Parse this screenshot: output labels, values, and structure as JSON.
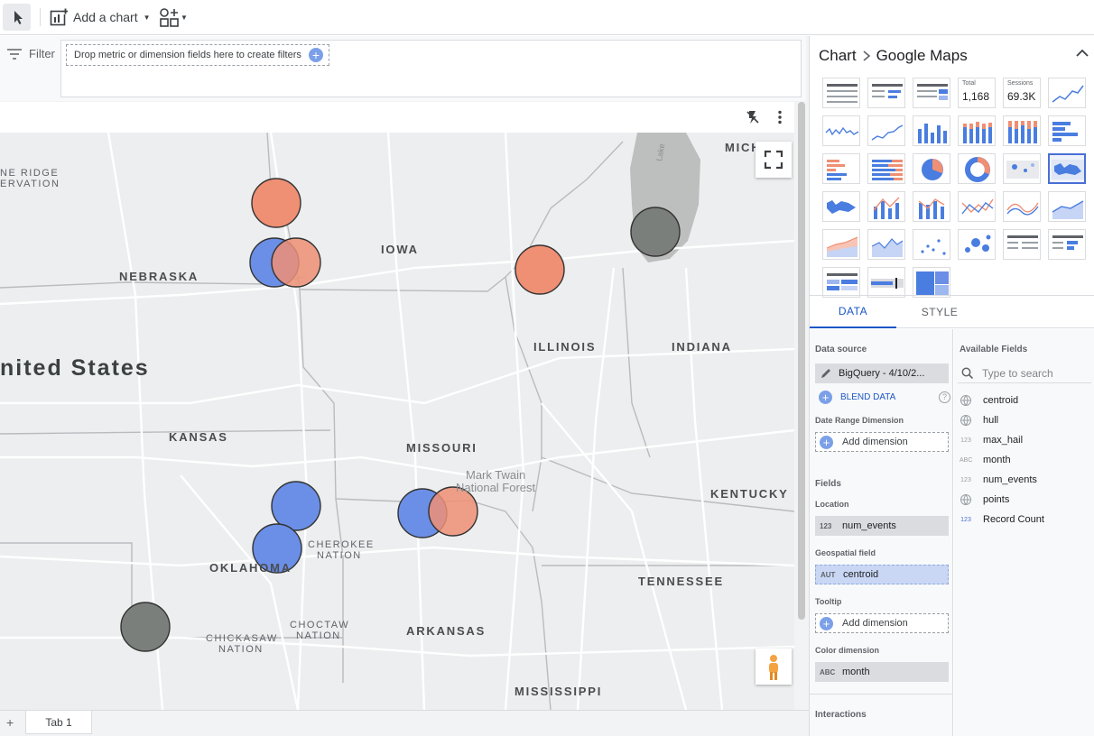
{
  "toolbar": {
    "add_chart_label": "Add a chart"
  },
  "filter": {
    "label": "Filter",
    "drop_hint": "Drop metric or dimension fields here to create filters"
  },
  "map": {
    "labels": [
      {
        "text": "NE RIDGE"
      },
      {
        "text": "ERVATION"
      },
      {
        "text": "NEBRASKA"
      },
      {
        "text": "IOWA"
      },
      {
        "text": "ILLINOIS"
      },
      {
        "text": "INDIANA"
      },
      {
        "text": "MICH"
      },
      {
        "text": "nited States"
      },
      {
        "text": "KANSAS"
      },
      {
        "text": "MISSOURI"
      },
      {
        "text": "Mark Twain"
      },
      {
        "text": "National Forest"
      },
      {
        "text": "KENTUCKY"
      },
      {
        "text": "CHEROKEE"
      },
      {
        "text": "NATION"
      },
      {
        "text": "OKLAHOMA"
      },
      {
        "text": "TENNESSEE"
      },
      {
        "text": "CHOCTAW"
      },
      {
        "text": "NATION"
      },
      {
        "text": "CHICKASAW"
      },
      {
        "text": "NATION"
      },
      {
        "text": "ARKANSAS"
      },
      {
        "text": "MISSISSIPPI"
      },
      {
        "text": "Lake"
      }
    ],
    "bubble_colors": {
      "orange": "#ef8f74",
      "blue": "#6b8fe6",
      "gray": "#7b7f7c"
    }
  },
  "tabs": {
    "tab1": "Tab 1"
  },
  "panel": {
    "crumb_parent": "Chart",
    "crumb_child": "Google Maps",
    "gallery": {
      "scorecard_total_label": "Total",
      "scorecard_total_value": "1,168",
      "scorecard_sessions_label": "Sessions",
      "scorecard_sessions_value": "69.3K"
    },
    "tab_data": "DATA",
    "tab_style": "STYLE",
    "data_source_title": "Data source",
    "data_source_value": "BigQuery - 4/10/2...",
    "blend_label": "BLEND DATA",
    "date_range_title": "Date Range Dimension",
    "add_dimension": "Add dimension",
    "fields_title": "Fields",
    "location_title": "Location",
    "location_type": "123",
    "location_value": "num_events",
    "geo_title": "Geospatial field",
    "geo_type": "AUT",
    "geo_value": "centroid",
    "tooltip_title": "Tooltip",
    "tooltip_add": "Add dimension",
    "color_title": "Color dimension",
    "color_type": "ABC",
    "color_value": "month",
    "interactions_title": "Interactions",
    "available_title": "Available Fields",
    "search_placeholder": "Type to search",
    "fields": [
      {
        "type": "geo",
        "name": "centroid"
      },
      {
        "type": "geo",
        "name": "hull"
      },
      {
        "type": "123",
        "name": "max_hail"
      },
      {
        "type": "ABC",
        "name": "month"
      },
      {
        "type": "123",
        "name": "num_events"
      },
      {
        "type": "geo",
        "name": "points"
      },
      {
        "type": "123",
        "name": "Record Count"
      }
    ],
    "accent": "#1a56c4"
  }
}
